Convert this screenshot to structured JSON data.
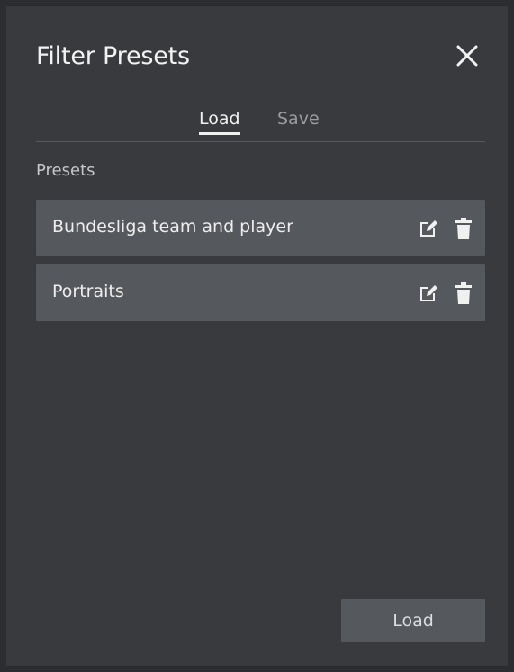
{
  "dialog": {
    "title": "Filter Presets",
    "close_icon": "close-icon"
  },
  "tabs": [
    {
      "label": "Load",
      "active": true
    },
    {
      "label": "Save",
      "active": false
    }
  ],
  "presets": {
    "section_label": "Presets",
    "items": [
      {
        "label": "Bundesliga team and player",
        "edit_icon": "edit-icon",
        "delete_icon": "trash-icon"
      },
      {
        "label": "Portraits",
        "edit_icon": "edit-icon",
        "delete_icon": "trash-icon"
      }
    ]
  },
  "footer": {
    "load_label": "Load"
  },
  "colors": {
    "panel_bg": "#383a3d",
    "row_bg": "#55585c",
    "text_primary": "#f2f2f2",
    "text_muted": "#9a9ca0"
  }
}
